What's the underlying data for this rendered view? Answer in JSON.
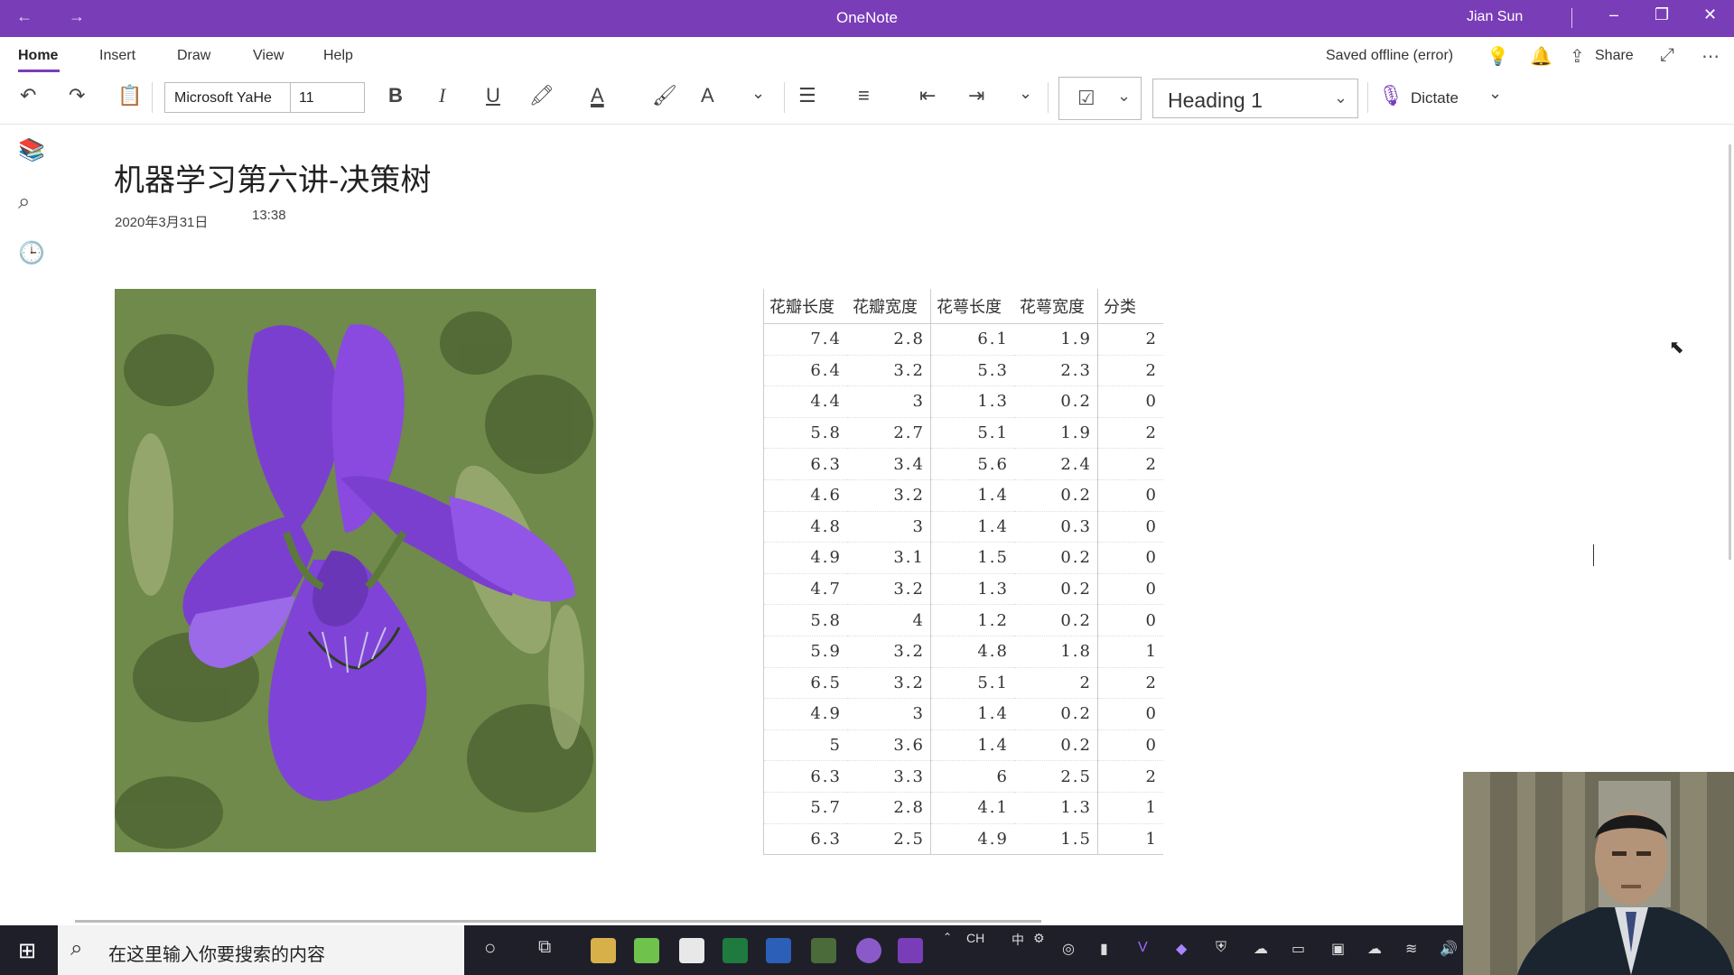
{
  "titlebar": {
    "app_title": "OneNote",
    "user_name": "Jian Sun"
  },
  "ribbon": {
    "tabs": [
      "Home",
      "Insert",
      "Draw",
      "View",
      "Help"
    ],
    "active_tab": "Home",
    "saved_status": "Saved offline (error)",
    "share_label": "Share"
  },
  "toolbar": {
    "font_name": "Microsoft YaHe",
    "font_size": "11",
    "style_name": "Heading 1",
    "dictate_label": "Dictate"
  },
  "page": {
    "title": "机器学习第六讲-决策树",
    "date": "2020年3月31日",
    "time": "13:38"
  },
  "table": {
    "headers": [
      "花瓣长度",
      "花瓣宽度",
      "花萼长度",
      "花萼宽度",
      "分类"
    ],
    "rows": [
      [
        "7.4",
        "2.8",
        "6.1",
        "1.9",
        "2"
      ],
      [
        "6.4",
        "3.2",
        "5.3",
        "2.3",
        "2"
      ],
      [
        "4.4",
        "3",
        "1.3",
        "0.2",
        "0"
      ],
      [
        "5.8",
        "2.7",
        "5.1",
        "1.9",
        "2"
      ],
      [
        "6.3",
        "3.4",
        "5.6",
        "2.4",
        "2"
      ],
      [
        "4.6",
        "3.2",
        "1.4",
        "0.2",
        "0"
      ],
      [
        "4.8",
        "3",
        "1.4",
        "0.3",
        "0"
      ],
      [
        "4.9",
        "3.1",
        "1.5",
        "0.2",
        "0"
      ],
      [
        "4.7",
        "3.2",
        "1.3",
        "0.2",
        "0"
      ],
      [
        "5.8",
        "4",
        "1.2",
        "0.2",
        "0"
      ],
      [
        "5.9",
        "3.2",
        "4.8",
        "1.8",
        "1"
      ],
      [
        "6.5",
        "3.2",
        "5.1",
        "2",
        "2"
      ],
      [
        "4.9",
        "3",
        "1.4",
        "0.2",
        "0"
      ],
      [
        "5",
        "3.6",
        "1.4",
        "0.2",
        "0"
      ],
      [
        "6.3",
        "3.3",
        "6",
        "2.5",
        "2"
      ],
      [
        "5.7",
        "2.8",
        "4.1",
        "1.3",
        "1"
      ],
      [
        "6.3",
        "2.5",
        "4.9",
        "1.5",
        "1"
      ]
    ]
  },
  "taskbar": {
    "search_placeholder": "在这里输入你要搜索的内容",
    "tray_lang": "CH",
    "tray_ime": "中"
  },
  "colors": {
    "accent": "#7a3db8",
    "iris_petal": "#7b3fd0",
    "leaf_green": "#6f8a4a",
    "taskbar": "#1f1f2a"
  }
}
